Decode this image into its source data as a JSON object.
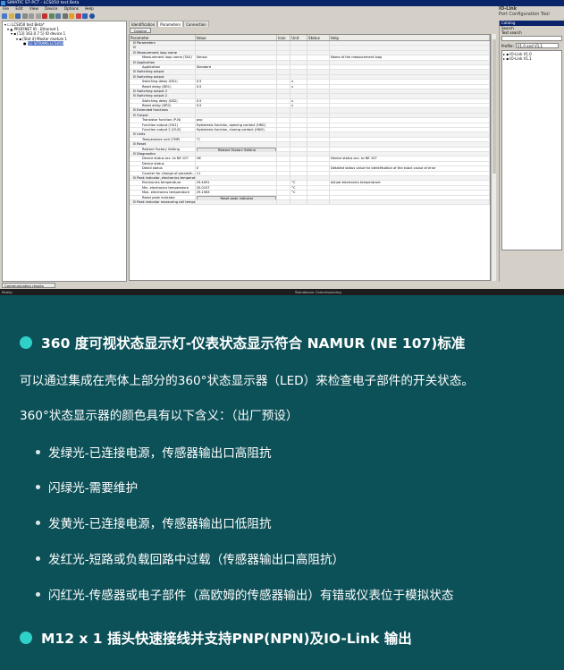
{
  "window": {
    "title": "SIMATIC S7-PCT - LCS050 test Beta"
  },
  "menu": [
    "File",
    "Edit",
    "View",
    "Device",
    "Options",
    "Help"
  ],
  "brand": {
    "line1": "IO-Link",
    "line2": "Port Configuration Tool"
  },
  "tree": [
    "LCS050 test Beta*",
    "PROFINET IO - Ethernet 1",
    "[13] 163.0.7 5] IO device 1",
    "[Slot 4] Master module 1",
    "[1] SITRANS LCS050"
  ],
  "tabs": [
    "Identification",
    "Parameters",
    "Connection"
  ],
  "column_filter": "Column filter",
  "grid": {
    "headers": [
      "Parameter",
      "Value",
      "Icon",
      "Unit",
      "Status",
      "Help"
    ],
    "rows": [
      [
        "⊟ Parameters",
        "",
        "",
        "",
        "",
        ""
      ],
      [
        "⊟",
        "",
        "",
        "",
        "",
        ""
      ],
      [
        "⊟ Measurement loop name",
        "",
        "",
        "",
        "",
        ""
      ],
      [
        "Measurement loop name (TAG)",
        "Sensor",
        "",
        "",
        "",
        "Name of the measurement loop"
      ],
      [
        "⊟ Application",
        "",
        "",
        "",
        "",
        ""
      ],
      [
        "Application",
        "Standard",
        "",
        "",
        "",
        ""
      ],
      [
        "⊟ Switching output",
        "",
        "",
        "",
        "",
        ""
      ],
      [
        "⊟ Switching output",
        "",
        "",
        "",
        "",
        ""
      ],
      [
        "Switching delay (DS1)",
        "0.5",
        "",
        "s",
        "",
        ""
      ],
      [
        "Reset delay (DR1)",
        "0.5",
        "",
        "s",
        "",
        ""
      ],
      [
        "⊟ Switching output 2",
        "",
        "",
        "",
        "",
        ""
      ],
      [
        "⊟ Switching output 2",
        "",
        "",
        "",
        "",
        ""
      ],
      [
        "Switching delay (DS2)",
        "0.5",
        "",
        "s",
        "",
        ""
      ],
      [
        "Reset delay (DR2)",
        "0.5",
        "",
        "s",
        "",
        ""
      ],
      [
        "⊟ Extended functions",
        "",
        "",
        "",
        "",
        ""
      ],
      [
        "⊟ Output",
        "",
        "",
        "",
        "",
        ""
      ],
      [
        "Transistor function (P-N)",
        "pnp",
        "",
        "",
        "",
        ""
      ],
      [
        "Function output (OU1)",
        "Hysteresis function, opening contact (HNC)",
        "",
        "",
        "",
        ""
      ],
      [
        "Function output 2 (OU2)",
        "Hysteresis function, closing contact (HNO)",
        "",
        "",
        "",
        ""
      ],
      [
        "⊟ Units",
        "",
        "",
        "",
        "",
        ""
      ],
      [
        "Temperature unit (TMP)",
        "°C",
        "",
        "",
        "",
        ""
      ],
      [
        "⊟ Reset",
        "",
        "",
        "",
        "",
        ""
      ],
      [
        "Restore Factory Setting",
        "[btn]Restore Factory Setting",
        "",
        "",
        "",
        ""
      ],
      [
        "⊟ Diagnostics",
        "",
        "",
        "",
        "",
        ""
      ],
      [
        "Device status acc. to NE 107",
        "OK",
        "",
        "",
        "",
        "Device status acc. to NE 107"
      ],
      [
        "Device status",
        "",
        "",
        "",
        "",
        ""
      ],
      [
        "Detail status",
        "0",
        "",
        "",
        "",
        "Detailed status value for identification of the exact cause of error"
      ],
      [
        "Counter for change of paramet...",
        "11",
        "",
        "",
        "",
        ""
      ],
      [
        "⊟ Peak indicator, electronics temperature",
        "",
        "",
        "",
        "",
        ""
      ],
      [
        "Electronics temperature",
        "29.4091",
        "",
        "°C",
        "",
        "Actual electronics temperature"
      ],
      [
        "Min. electronics temperature",
        "20.0107",
        "",
        "°C",
        "",
        ""
      ],
      [
        "Max. electronics temperature",
        "29.1563",
        "",
        "°C",
        "",
        ""
      ],
      [
        "Reset peak indicator",
        "[btn]Reset peak indicator",
        "",
        "",
        "",
        ""
      ],
      [
        "⊟ Peak indicator measuring cell temperature",
        "",
        "",
        "",
        "",
        ""
      ]
    ]
  },
  "right_panel": {
    "header": "Catalog",
    "search_label": "Search",
    "text_search_label": "Text search",
    "profile_label": "Profile:",
    "profile_value": "V1.0 and V1.1",
    "items": [
      "IO-Link V1.0",
      "IO-Link V1.1"
    ]
  },
  "results_tab": "Communication results",
  "status": {
    "left": "Ready",
    "right": "Standalone  Commissioning"
  },
  "content": {
    "h1": "360 度可视状态显示灯-仪表状态显示符合 NAMUR (NE 107)标准",
    "p1": "可以通过集成在壳体上部分的360°状态显示器（LED）来检查电子部件的开关状态。",
    "p2": "360°状态显示器的颜色具有以下含义：（出厂预设）",
    "bullets": [
      "发绿光-已连接电源，传感器输出口高阻抗",
      "闪绿光-需要维护",
      "发黄光-已连接电源，传感器输出口低阻抗",
      "发红光-短路或负载回路中过载（传感器输出口高阻抗）",
      "闪红光-传感器或电子部件（高欧姆的传感器输出）有错或仪表位于模拟状态"
    ],
    "h2": "M12 x 1 插头快速接线并支持PNP(NPN)及IO-Link 输出"
  },
  "colors": {
    "accent_dot": "#2fd0c8",
    "background": "#0d5158"
  }
}
